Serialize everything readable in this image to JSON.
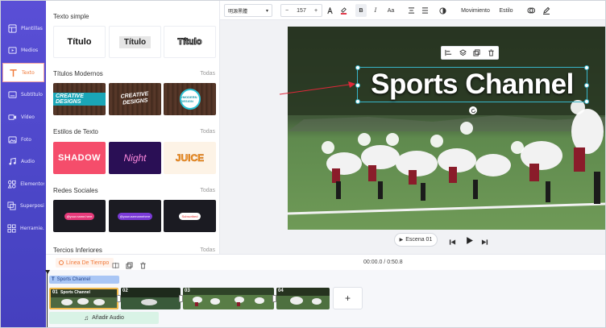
{
  "sidebar": {
    "items": [
      {
        "label": "Plantillas",
        "icon": "template-icon"
      },
      {
        "label": "Medios",
        "icon": "media-folder-icon"
      },
      {
        "label": "Texto",
        "icon": "text-icon",
        "active": true
      },
      {
        "label": "Subtítulo",
        "icon": "subtitle-icon"
      },
      {
        "label": "Vídeo",
        "icon": "video-icon"
      },
      {
        "label": "Foto",
        "icon": "photo-icon"
      },
      {
        "label": "Audio",
        "icon": "audio-icon"
      },
      {
        "label": "Elementos",
        "icon": "elements-icon"
      },
      {
        "label": "Superposi...",
        "icon": "overlay-icon"
      },
      {
        "label": "Herramie...",
        "icon": "tools-icon"
      }
    ]
  },
  "panel": {
    "simple": {
      "title": "Texto simple",
      "cards": [
        "Título",
        "Título",
        "Título"
      ]
    },
    "modern": {
      "title": "Títulos Modernos",
      "all": "Todas",
      "cards": [
        "CREATIVE DESIGNS",
        "CREATIVE DESIGNS",
        "#MODERN DESIGN"
      ]
    },
    "styles": {
      "title": "Estilos de Texto",
      "all": "Todas",
      "cards": [
        "SHADOW",
        "Night",
        "JUICE"
      ]
    },
    "social": {
      "title": "Redes Sociales",
      "all": "Todas",
      "cards": [
        "@your.name.here",
        "@yourusernamehere",
        "Subscribed"
      ]
    },
    "lower": {
      "title": "Tercios Inferiores",
      "all": "Todas"
    }
  },
  "toolbar": {
    "font": "明源黑體",
    "font_size": "157",
    "minus": "−",
    "plus": "+",
    "bold": "B",
    "italic": "I",
    "case": "Aa",
    "movement": "Movimiento",
    "style": "Estilo"
  },
  "canvas": {
    "title_text": "Sports Channel",
    "scene_label": "Escena 01"
  },
  "timeline": {
    "tab_label": "Línea De Tiempo",
    "time": "00:00.0 / 0:50.8",
    "text_track": "Sports Channel",
    "clips": [
      {
        "num": "01",
        "caption": "Sports Channel"
      },
      {
        "num": "02"
      },
      {
        "num": "03"
      },
      {
        "num": "04"
      }
    ],
    "add_clip": "+",
    "add_audio": "Añadir Audio"
  },
  "colors": {
    "rail": "#4b46c7",
    "accent": "#f07a3a",
    "selection": "#37b5c9",
    "arrow": "#e0283a",
    "text_track": "#a9c6f5",
    "audio_track": "#d9f3e6"
  }
}
